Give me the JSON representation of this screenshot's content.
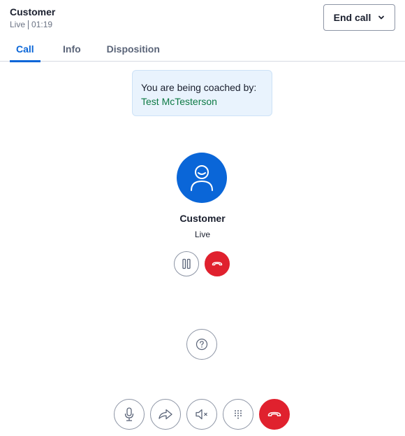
{
  "header": {
    "title": "Customer",
    "status": "Live",
    "timer": "01:19",
    "end_call_label": "End call"
  },
  "tabs": [
    {
      "label": "Call",
      "active": true
    },
    {
      "label": "Info",
      "active": false
    },
    {
      "label": "Disposition",
      "active": false
    }
  ],
  "coaching": {
    "label": "You are being coached by:",
    "coach_name": "Test McTesterson"
  },
  "party": {
    "name": "Customer",
    "status": "Live"
  },
  "icons": {
    "avatar": "user-icon",
    "hold": "pause-icon",
    "hangup": "phone-hangup-icon",
    "help": "question-icon",
    "mic": "microphone-icon",
    "transfer": "forward-arrow-icon",
    "speaker": "speaker-muted-icon",
    "keypad": "keypad-icon"
  },
  "colors": {
    "accent": "#0a66d8",
    "danger": "#e0212e",
    "coach_name": "#0d7a44",
    "coach_bg": "#e9f3fd"
  }
}
